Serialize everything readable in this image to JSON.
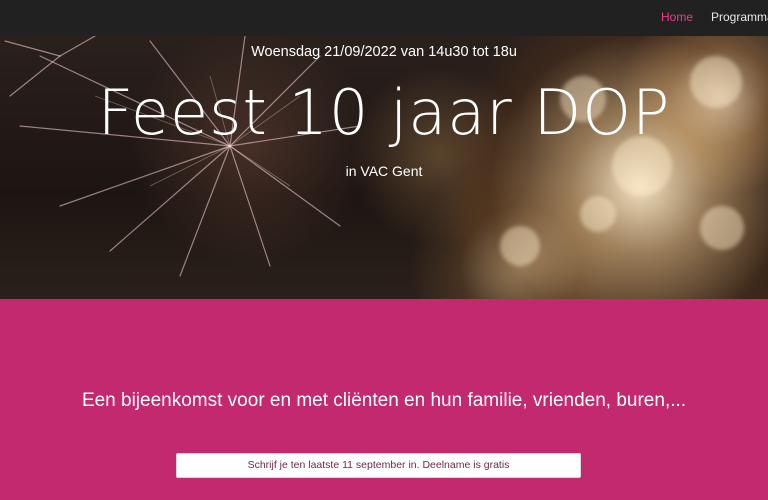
{
  "nav": {
    "items": [
      {
        "label": "Home",
        "active": true
      },
      {
        "label": "Programma",
        "active": false
      }
    ],
    "active_color": "#e83e8c"
  },
  "hero": {
    "date": "Woensdag 21/09/2022 van 14u30 tot 18u",
    "title": "Feest 10 jaar DOP",
    "location": "in VAC Gent"
  },
  "main": {
    "intro": "Een bijeenkomst voor en met cliënten en hun familie, vrienden, buren,...",
    "signup_label": "Schrijf je ten laatste 11 september in. Deelname is gratis",
    "background_color": "#c2296e"
  }
}
